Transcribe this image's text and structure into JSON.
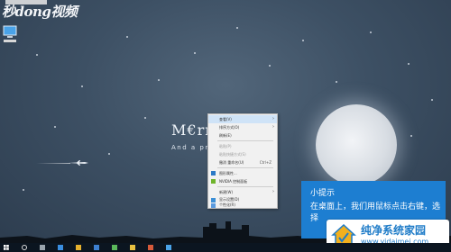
{
  "watermark": "秒dong视频",
  "wallpaper": {
    "headline": "M€rry",
    "subline": "And a pro"
  },
  "context_menu": {
    "items": [
      {
        "label": "查看(V)",
        "shortcut": "",
        "submenu": true,
        "highlighted": true
      },
      {
        "label": "排序方式(O)",
        "shortcut": "",
        "submenu": true
      },
      {
        "label": "刷新(E)",
        "shortcut": "",
        "submenu": false
      },
      {
        "label": "粘贴(P)",
        "shortcut": "",
        "submenu": false,
        "disabled": true
      },
      {
        "label": "粘贴快捷方式(S)",
        "shortcut": "",
        "submenu": false,
        "disabled": true
      },
      {
        "label": "撤消 重命名(U)",
        "shortcut": "Ctrl+Z",
        "submenu": false
      },
      {
        "label": "图形属性...",
        "shortcut": "",
        "submenu": false,
        "icon": "graphics-icon"
      },
      {
        "label": "NVIDIA 控制面板",
        "shortcut": "",
        "submenu": false,
        "icon": "nvidia-icon"
      },
      {
        "label": "新建(W)",
        "shortcut": "",
        "submenu": true
      },
      {
        "label": "显示设置(D)",
        "shortcut": "",
        "submenu": false,
        "icon": "display-icon"
      },
      {
        "label": "个性化(R)",
        "shortcut": "",
        "submenu": false,
        "icon": "personalize-icon"
      }
    ]
  },
  "tip": {
    "title": "小提示",
    "text": "在桌面上，我们用鼠标点击右键，选择"
  },
  "badge": {
    "title": "纯净系统家园",
    "url": "www.yidaimei.com"
  },
  "colors": {
    "tip_bg": "#1d7ed1",
    "badge_text": "#1f7cc8",
    "taskbar": "#0b1520"
  }
}
